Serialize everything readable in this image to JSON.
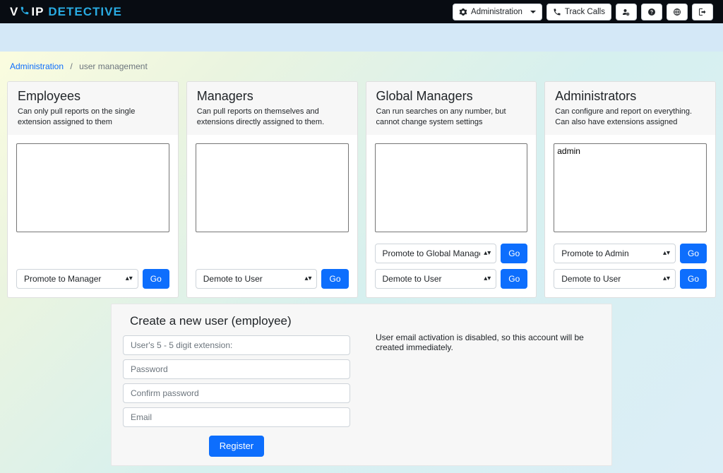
{
  "brand": {
    "prefix": "V",
    "mid": "IP",
    "suffix": "DETECTIVE"
  },
  "nav": {
    "admin": "Administration",
    "track": "Track Calls"
  },
  "breadcrumb": {
    "root": "Administration",
    "current": "user management"
  },
  "columns": {
    "employees": {
      "title": "Employees",
      "desc": "Can only pull reports on the single extension assigned to them",
      "items": [],
      "action1": "Promote to Manager",
      "go": "Go"
    },
    "managers": {
      "title": "Managers",
      "desc": "Can pull reports on themselves and extensions directly assigned to them.",
      "items": [],
      "action1": "Demote to User",
      "go": "Go"
    },
    "global": {
      "title": "Global Managers",
      "desc": "Can run searches on any number, but cannot change system settings",
      "items": [],
      "action1": "Promote to Global Manager",
      "action2": "Demote to User",
      "go": "Go"
    },
    "admins": {
      "title": "Administrators",
      "desc": "Can configure and report on everything. Can also have extensions assigned",
      "items": [
        "admin"
      ],
      "action1": "Promote to Admin",
      "action2": "Demote to User",
      "go": "Go"
    }
  },
  "create": {
    "title": "Create a new user (employee)",
    "note": "User email activation is disabled, so this account will be created immediately.",
    "ext_placeholder": "User's 5 - 5 digit extension:",
    "pw_placeholder": "Password",
    "pw2_placeholder": "Confirm password",
    "email_placeholder": "Email",
    "register": "Register"
  }
}
